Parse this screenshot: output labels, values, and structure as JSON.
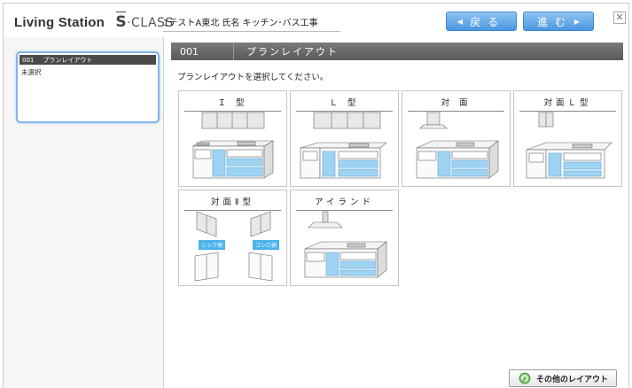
{
  "header": {
    "brand": "Living Station",
    "product_letter": "S",
    "product_suffix": "·CLASS",
    "project_info": "1テストA東北 氏名 キッチン･バス工事",
    "back_label": "戻る",
    "next_label": "進む",
    "close_label": "✕"
  },
  "sidebar": {
    "step_number": "001",
    "step_title": "プランレイアウト",
    "step_status": "未選択"
  },
  "main": {
    "step_number": "001",
    "step_title": "プランレイアウト",
    "instruction": "プランレイアウトを選択してください。",
    "layouts": [
      {
        "label": "Ｉ 型"
      },
      {
        "label": "Ｌ 型"
      },
      {
        "label": "対 面"
      },
      {
        "label": "対面Ｌ型"
      },
      {
        "label": "対面Ⅱ型"
      },
      {
        "label": "アイランド"
      }
    ],
    "sink_side_label": "シンク側",
    "stove_side_label": "コンロ側",
    "other_layout_button": "その他のレイアウト"
  },
  "colors": {
    "accent_blue": "#4b97e0",
    "cabinet_blue": "#9fd3f2",
    "header_bar": "#666666"
  }
}
